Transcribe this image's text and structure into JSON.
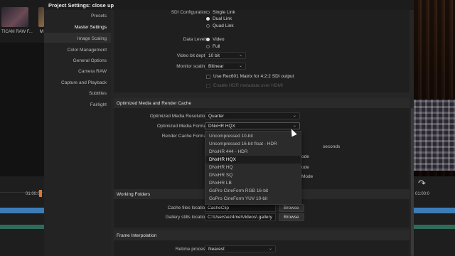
{
  "background": {
    "media_pool": {
      "clip1_label": "TICAM RAW F...",
      "clip2_label": "M"
    },
    "timeline": {
      "timecode_left": "01:00:0",
      "timecode_right": "01:00:0"
    },
    "icons": {
      "redo": "redo-icon"
    }
  },
  "dialog": {
    "title": "Project Settings:  close up",
    "sidebar": {
      "items": [
        {
          "label": "Presets"
        },
        {
          "label": "Master Settings",
          "active": true
        },
        {
          "label": "Image Scaling"
        },
        {
          "label": "Color Management"
        },
        {
          "label": "General Options"
        },
        {
          "label": "Camera RAW"
        },
        {
          "label": "Capture and Playback"
        },
        {
          "label": "Subtitles"
        },
        {
          "label": "Fairlight"
        }
      ]
    },
    "video_monitoring": {
      "sdi_configuration_label": "SDI Configuration",
      "sdi_options": [
        "Single Link",
        "Dual Link",
        "Quad Link"
      ],
      "sdi_selected": "Dual Link",
      "data_levels_label": "Data Levels",
      "data_levels_options": [
        "Video",
        "Full"
      ],
      "data_levels_selected": "Video",
      "bit_depth_label": "Video bit depth",
      "bit_depth_value": "10 bit",
      "monitor_scaling_label": "Monitor scaling",
      "monitor_scaling_value": "Bilinear",
      "rec601_label": "Use Rec601 Matrix for 4:2:2 SDI output",
      "hdr_metadata_label": "Enable HDR metadata over HDMI"
    },
    "optimized_media": {
      "section_title": "Optimized Media and Render Cache",
      "resolution_label": "Optimized Media Resolution",
      "resolution_value": "Quarter",
      "format_label": "Optimized Media Format",
      "format_value": "DNxHR HQX",
      "render_cache_label": "Render Cache Format",
      "behind_text": [
        "seconds",
        "ode",
        "ode",
        "r Mode"
      ],
      "format_options": [
        "Uncompressed 10-bit",
        "Uncompressed 16-bit float - HDR",
        "DNxHR 444 - HDR",
        "DNxHR HQX",
        "DNxHR HQ",
        "DNxHR SQ",
        "DNxHR LB",
        "GoPro CineForm RGB 16-bit",
        "GoPro CineForm YUV 10-bit"
      ],
      "format_selected_index": 3
    },
    "working_folders": {
      "section_title": "Working Folders",
      "cache_label": "Cache files location",
      "cache_value": "CacheClip",
      "gallery_label": "Gallery stills location",
      "gallery_value": "C:\\Users\\ez4me\\Videos\\.gallery",
      "browse_label": "Browse"
    },
    "frame_interpolation": {
      "section_title": "Frame Interpolation",
      "retime_label": "Retime process",
      "retime_value": "Nearest"
    }
  }
}
